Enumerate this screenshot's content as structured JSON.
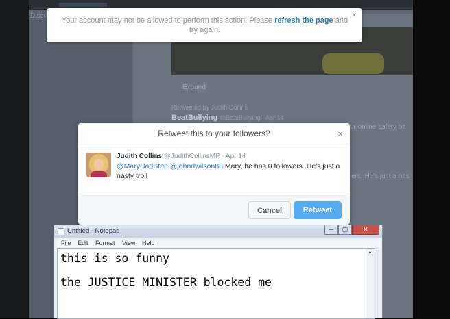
{
  "background": {
    "left_tab": "Disco",
    "expand": "Expand",
    "retweeted_by": "Retweeted by Judith Collins",
    "tweet_name": "BeatBullying",
    "tweet_handle": "@BeatBullying · Apr 14",
    "snippet_1": "ur online safety pa",
    "snippet_2": "ers. He's just a nas"
  },
  "alert": {
    "text_before": "Your account may not be allowed to perform this action. Please ",
    "link": "refresh the page",
    "text_after": " and try again.",
    "close": "×"
  },
  "dialog": {
    "title": "Retweet this to your followers?",
    "close": "×",
    "tweet": {
      "name": "Judith Collins",
      "handle": "@JudithCollinsMP",
      "date": "· Apr 14",
      "mention_1": "@MaryHadStan",
      "mention_2": "@johndwilson88",
      "text": " Mary, he has 0 followers. He's just a nasty troll"
    },
    "cancel_label": "Cancel",
    "retweet_label": "Retweet"
  },
  "notepad": {
    "title": "Untitled - Notepad",
    "menu": [
      "File",
      "Edit",
      "Format",
      "View",
      "Help"
    ],
    "lines": [
      "this is so funny",
      "the JUSTICE MINISTER blocked me"
    ],
    "minimize": "─",
    "maximize": "▢",
    "close": "✕"
  },
  "colors": {
    "link": "#2a7eb8",
    "retweet_button": "#55acee",
    "notepad_close": "#c7504a"
  }
}
